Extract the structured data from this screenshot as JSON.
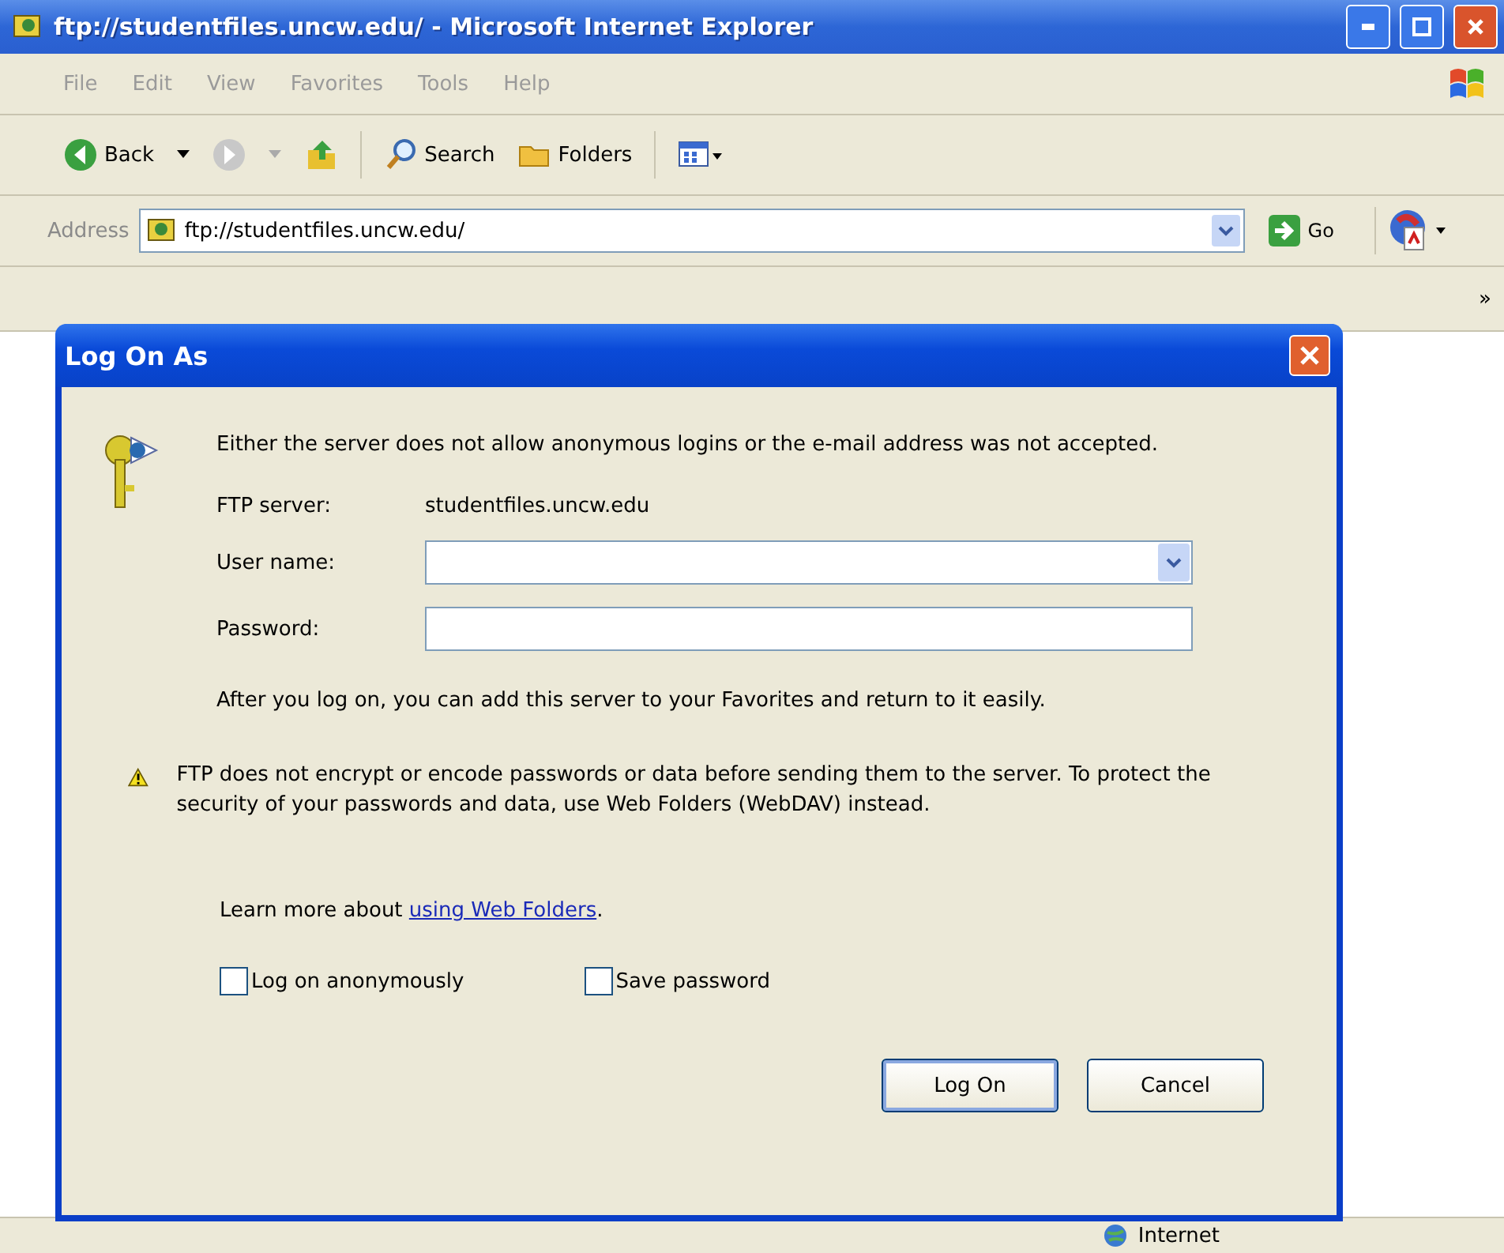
{
  "window": {
    "title": "ftp://studentfiles.uncw.edu/ - Microsoft Internet Explorer"
  },
  "menu": [
    "File",
    "Edit",
    "View",
    "Favorites",
    "Tools",
    "Help"
  ],
  "toolbar": [
    {
      "kind": "back",
      "label": "Back"
    },
    {
      "kind": "forward"
    },
    {
      "kind": "up"
    },
    {
      "kind": "search",
      "label": "Search"
    },
    {
      "kind": "folders",
      "label": "Folders"
    },
    {
      "kind": "views"
    }
  ],
  "address": {
    "label": "Address",
    "value": "ftp://studentfiles.uncw.edu/",
    "go": "Go"
  },
  "links_bar": {
    "chevron": "»"
  },
  "status_bar": {
    "zone": "Internet"
  },
  "dialog": {
    "title": "Log On As",
    "message": "Either the server does not allow anonymous logins or the e-mail address was not accepted.",
    "server_label": "FTP server:",
    "server": "studentfiles.uncw.edu",
    "fields": [
      {
        "kind": "combo",
        "label": "User name:"
      },
      {
        "kind": "password",
        "label": "Password:"
      }
    ],
    "info": "After you log on, you can add this server to your Favorites and return to it easily.",
    "warning": "FTP does not encrypt or encode passwords or data before sending them to the server.  To protect the security of your passwords and data, use Web Folders (WebDAV) instead.",
    "learn_more": {
      "before": "Learn more about ",
      "link": "using Web Folders",
      "after": "."
    },
    "checkboxes": [
      {
        "label": "Log on anonymously",
        "checked": false
      },
      {
        "label": "Save password",
        "checked": false
      }
    ],
    "buttons": [
      {
        "label": "Log On",
        "default": true
      },
      {
        "label": "Cancel",
        "default": false
      }
    ]
  }
}
